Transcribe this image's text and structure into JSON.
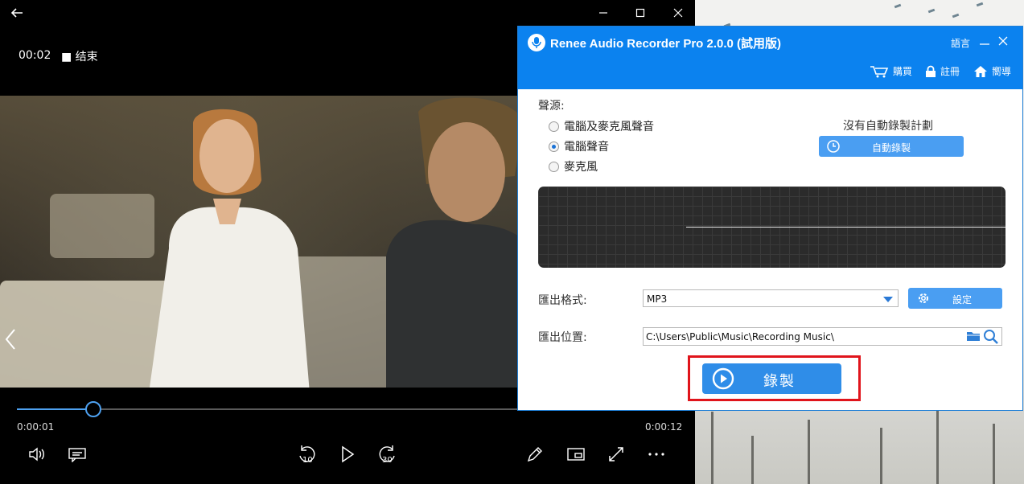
{
  "player": {
    "recording_time": "00:02",
    "stop_label": "■ 结束",
    "current_time": "0:00:01",
    "total_time": "0:00:12",
    "progress_fraction": 0.116,
    "skip_back_seconds": "10",
    "skip_forward_seconds": "30"
  },
  "recorder": {
    "title": "Renee Audio Recorder Pro 2.0.0 (試用版)",
    "language": "語言",
    "header_links": {
      "buy": "購買",
      "register": "註冊",
      "guide": "嚮導"
    },
    "source_label": "聲源:",
    "sources": [
      {
        "label": "電腦及麥克風聲音",
        "selected": false
      },
      {
        "label": "電腦聲音",
        "selected": true
      },
      {
        "label": "麥克風",
        "selected": false
      }
    ],
    "no_schedule": "沒有自動錄製計劃",
    "auto_record": "自動錄製",
    "format_label": "匯出格式:",
    "format_value": "MP3",
    "settings": "設定",
    "location_label": "匯出位置:",
    "location_value": "C:\\Users\\Public\\Music\\Recording Music\\",
    "record": "錄製"
  },
  "colors": {
    "header_blue": "#0b82ef",
    "button_blue": "#4a9ef2",
    "progress_blue": "#4ea1f0",
    "highlight_red": "#e0141b"
  }
}
